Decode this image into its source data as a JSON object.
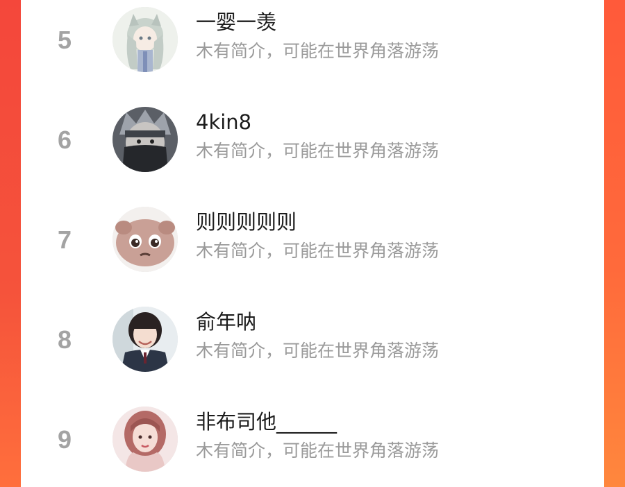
{
  "theme": {
    "accent": "#f7433a",
    "accent_end": "#ff7a3c",
    "rank_color": "#a3a3a3",
    "name_color": "#1c1c1c",
    "bio_color": "#9a9a9a"
  },
  "ranking": {
    "items": [
      {
        "rank": "5",
        "name": "一婴一羡",
        "bio": "木有简介，可能在世界角落游荡",
        "avatar": "anime-girl-avatar"
      },
      {
        "rank": "6",
        "name": "4kin8",
        "bio": "木有简介，可能在世界角落游荡",
        "avatar": "masked-ninja-avatar"
      },
      {
        "rank": "7",
        "name": "则则则则则",
        "bio": "木有简介，可能在世界角落游荡",
        "avatar": "cartoon-face-avatar"
      },
      {
        "rank": "8",
        "name": "俞年呐",
        "bio": "木有简介，可能在世界角落游荡",
        "avatar": "student-girl-avatar"
      },
      {
        "rank": "9",
        "name": "非布司他______",
        "bio": "木有简介，可能在世界角落游荡",
        "avatar": "portrait-girl-avatar"
      }
    ]
  }
}
